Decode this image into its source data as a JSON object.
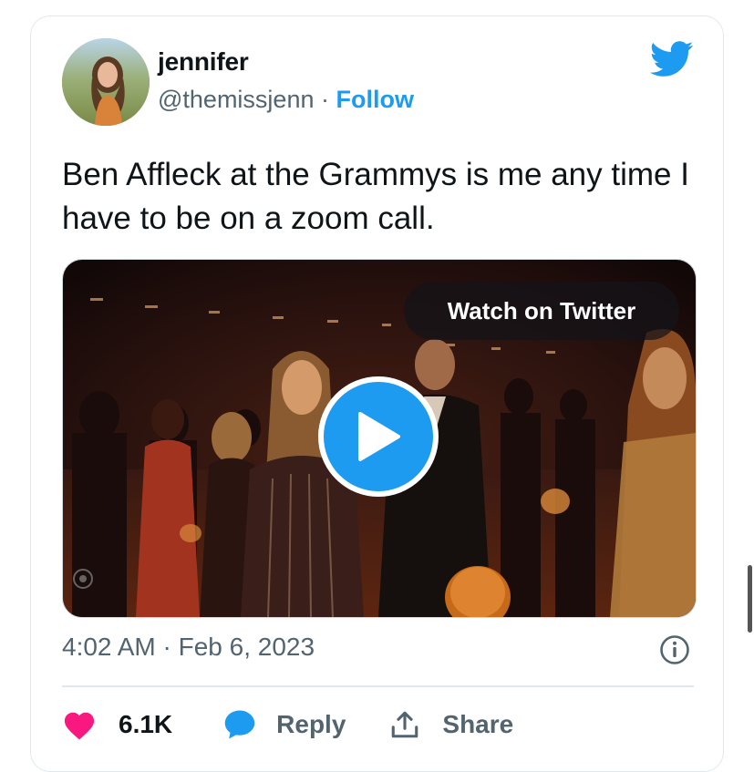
{
  "tweet": {
    "display_name": "jennifer",
    "handle": "@themissjenn",
    "separator": "·",
    "follow_label": "Follow",
    "text": "Ben Affleck at the Grammys is me any time I have to be on a zoom call.",
    "timestamp": "4:02 AM · Feb 6, 2023"
  },
  "media": {
    "watch_label": "Watch on Twitter"
  },
  "actions": {
    "like_count": "6.1K",
    "reply_label": "Reply",
    "share_label": "Share"
  },
  "icons": {
    "brand": "twitter-bird-icon",
    "like": "heart-icon",
    "reply": "speech-bubble-icon",
    "share": "upload-arrow-icon",
    "info": "info-icon",
    "play": "play-icon"
  },
  "colors": {
    "twitter_blue": "#1d9bf0",
    "like_pink": "#f91880",
    "secondary_text": "#536471"
  }
}
